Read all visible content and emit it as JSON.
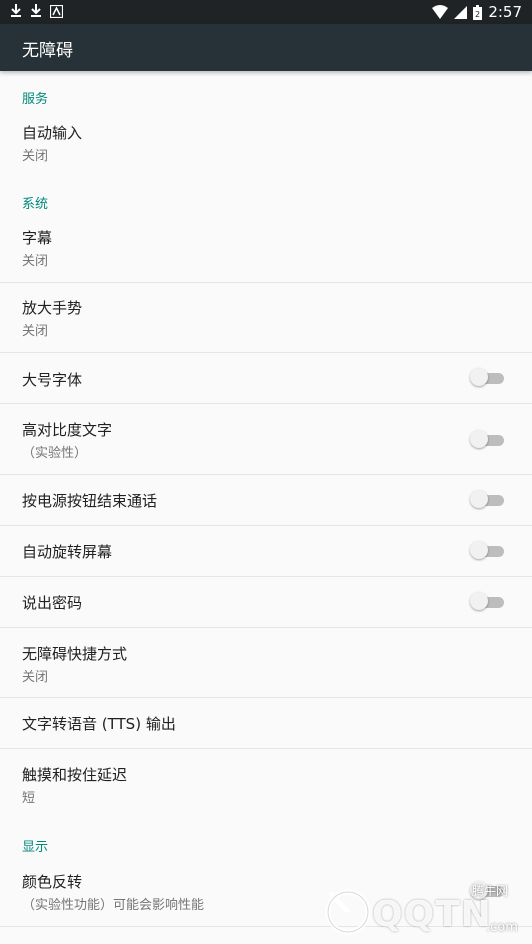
{
  "status_bar": {
    "time": "2:57",
    "battery_level": "2"
  },
  "app_bar": {
    "title": "无障碍"
  },
  "sections": {
    "services": "服务",
    "system": "系统",
    "display": "显示"
  },
  "items": {
    "auto_input": {
      "title": "自动输入",
      "subtitle": "关闭"
    },
    "captions": {
      "title": "字幕",
      "subtitle": "关闭"
    },
    "magnification": {
      "title": "放大手势",
      "subtitle": "关闭"
    },
    "large_text": {
      "title": "大号字体",
      "on": false
    },
    "high_contrast": {
      "title": "高对比度文字",
      "subtitle": "（实验性）",
      "on": false
    },
    "power_ends_call": {
      "title": "按电源按钮结束通话",
      "on": false
    },
    "auto_rotate": {
      "title": "自动旋转屏幕",
      "on": false
    },
    "speak_passwords": {
      "title": "说出密码",
      "on": false
    },
    "shortcut": {
      "title": "无障碍快捷方式",
      "subtitle": "关闭"
    },
    "tts": {
      "title": "文字转语音 (TTS) 输出"
    },
    "touch_delay": {
      "title": "触摸和按住延迟",
      "subtitle": "短"
    },
    "color_inversion": {
      "title": "颜色反转",
      "subtitle": "（实验性功能）可能会影响性能",
      "on": false
    }
  },
  "watermark": {
    "logo_text": "QQTN",
    "cn_text": "腾牛网",
    "suffix": ".com"
  }
}
